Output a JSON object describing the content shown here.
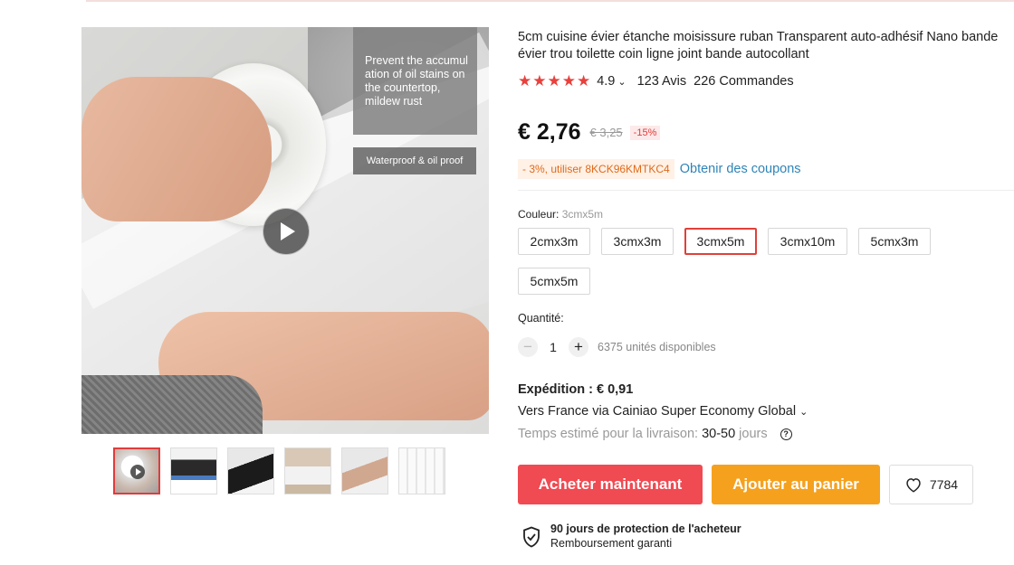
{
  "product": {
    "title": "5cm cuisine évier étanche moisissure ruban Transparent auto-adhésif Nano bande évier trou toilette coin ligne joint bande autocollant",
    "rating": {
      "stars": 5,
      "score": "4.9",
      "reviews": "123 Avis",
      "orders": "226 Commandes"
    },
    "price": {
      "current": "€ 2,76",
      "original": "€ 3,25",
      "discount": "-15%"
    },
    "coupon": {
      "code_text": "- 3%, utiliser 8KCK96KMTKC4",
      "link": "Obtenir des coupons"
    }
  },
  "gallery": {
    "promo_text_1": "Prevent the accumul ation of oil stains on the countertop, mildew rust",
    "promo_text_2": "Waterproof & oil proof",
    "thumbnail_count": 6,
    "active_thumbnail": 0
  },
  "color": {
    "label": "Couleur:",
    "selected": "3cmx5m",
    "options": [
      "2cmx3m",
      "3cmx3m",
      "3cmx5m",
      "3cmx10m",
      "5cmx3m",
      "5cmx5m"
    ]
  },
  "quantity": {
    "label": "Quantité:",
    "minus": "−",
    "value": "1",
    "plus": "+",
    "stock": "6375 unités disponibles"
  },
  "shipping": {
    "title": "Expédition : € 0,91",
    "method": "Vers France via Cainiao Super Economy Global",
    "eta_prefix": "Temps estimé pour la livraison:",
    "eta_value": "30-50",
    "eta_suffix": "jours",
    "help": "?"
  },
  "actions": {
    "buy": "Acheter maintenant",
    "cart": "Ajouter au panier",
    "wishlist_count": "7784"
  },
  "protection": {
    "title": "90 jours de protection de l'acheteur",
    "subtitle": "Remboursement garanti"
  },
  "colors": {
    "accent_red": "#f04a52",
    "accent_orange": "#f5a11e",
    "star": "#e8413c",
    "link": "#2f84b8"
  }
}
